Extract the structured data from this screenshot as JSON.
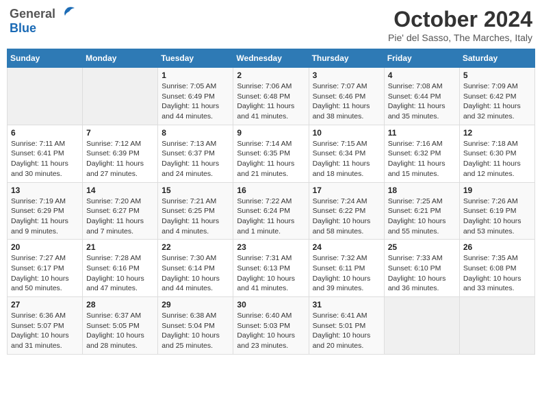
{
  "header": {
    "logo_general": "General",
    "logo_blue": "Blue",
    "month_title": "October 2024",
    "location": "Pie' del Sasso, The Marches, Italy"
  },
  "days_of_week": [
    "Sunday",
    "Monday",
    "Tuesday",
    "Wednesday",
    "Thursday",
    "Friday",
    "Saturday"
  ],
  "weeks": [
    [
      {
        "day": null
      },
      {
        "day": null
      },
      {
        "day": 1,
        "sunrise": "Sunrise: 7:05 AM",
        "sunset": "Sunset: 6:49 PM",
        "daylight": "Daylight: 11 hours and 44 minutes."
      },
      {
        "day": 2,
        "sunrise": "Sunrise: 7:06 AM",
        "sunset": "Sunset: 6:48 PM",
        "daylight": "Daylight: 11 hours and 41 minutes."
      },
      {
        "day": 3,
        "sunrise": "Sunrise: 7:07 AM",
        "sunset": "Sunset: 6:46 PM",
        "daylight": "Daylight: 11 hours and 38 minutes."
      },
      {
        "day": 4,
        "sunrise": "Sunrise: 7:08 AM",
        "sunset": "Sunset: 6:44 PM",
        "daylight": "Daylight: 11 hours and 35 minutes."
      },
      {
        "day": 5,
        "sunrise": "Sunrise: 7:09 AM",
        "sunset": "Sunset: 6:42 PM",
        "daylight": "Daylight: 11 hours and 32 minutes."
      }
    ],
    [
      {
        "day": 6,
        "sunrise": "Sunrise: 7:11 AM",
        "sunset": "Sunset: 6:41 PM",
        "daylight": "Daylight: 11 hours and 30 minutes."
      },
      {
        "day": 7,
        "sunrise": "Sunrise: 7:12 AM",
        "sunset": "Sunset: 6:39 PM",
        "daylight": "Daylight: 11 hours and 27 minutes."
      },
      {
        "day": 8,
        "sunrise": "Sunrise: 7:13 AM",
        "sunset": "Sunset: 6:37 PM",
        "daylight": "Daylight: 11 hours and 24 minutes."
      },
      {
        "day": 9,
        "sunrise": "Sunrise: 7:14 AM",
        "sunset": "Sunset: 6:35 PM",
        "daylight": "Daylight: 11 hours and 21 minutes."
      },
      {
        "day": 10,
        "sunrise": "Sunrise: 7:15 AM",
        "sunset": "Sunset: 6:34 PM",
        "daylight": "Daylight: 11 hours and 18 minutes."
      },
      {
        "day": 11,
        "sunrise": "Sunrise: 7:16 AM",
        "sunset": "Sunset: 6:32 PM",
        "daylight": "Daylight: 11 hours and 15 minutes."
      },
      {
        "day": 12,
        "sunrise": "Sunrise: 7:18 AM",
        "sunset": "Sunset: 6:30 PM",
        "daylight": "Daylight: 11 hours and 12 minutes."
      }
    ],
    [
      {
        "day": 13,
        "sunrise": "Sunrise: 7:19 AM",
        "sunset": "Sunset: 6:29 PM",
        "daylight": "Daylight: 11 hours and 9 minutes."
      },
      {
        "day": 14,
        "sunrise": "Sunrise: 7:20 AM",
        "sunset": "Sunset: 6:27 PM",
        "daylight": "Daylight: 11 hours and 7 minutes."
      },
      {
        "day": 15,
        "sunrise": "Sunrise: 7:21 AM",
        "sunset": "Sunset: 6:25 PM",
        "daylight": "Daylight: 11 hours and 4 minutes."
      },
      {
        "day": 16,
        "sunrise": "Sunrise: 7:22 AM",
        "sunset": "Sunset: 6:24 PM",
        "daylight": "Daylight: 11 hours and 1 minute."
      },
      {
        "day": 17,
        "sunrise": "Sunrise: 7:24 AM",
        "sunset": "Sunset: 6:22 PM",
        "daylight": "Daylight: 10 hours and 58 minutes."
      },
      {
        "day": 18,
        "sunrise": "Sunrise: 7:25 AM",
        "sunset": "Sunset: 6:21 PM",
        "daylight": "Daylight: 10 hours and 55 minutes."
      },
      {
        "day": 19,
        "sunrise": "Sunrise: 7:26 AM",
        "sunset": "Sunset: 6:19 PM",
        "daylight": "Daylight: 10 hours and 53 minutes."
      }
    ],
    [
      {
        "day": 20,
        "sunrise": "Sunrise: 7:27 AM",
        "sunset": "Sunset: 6:17 PM",
        "daylight": "Daylight: 10 hours and 50 minutes."
      },
      {
        "day": 21,
        "sunrise": "Sunrise: 7:28 AM",
        "sunset": "Sunset: 6:16 PM",
        "daylight": "Daylight: 10 hours and 47 minutes."
      },
      {
        "day": 22,
        "sunrise": "Sunrise: 7:30 AM",
        "sunset": "Sunset: 6:14 PM",
        "daylight": "Daylight: 10 hours and 44 minutes."
      },
      {
        "day": 23,
        "sunrise": "Sunrise: 7:31 AM",
        "sunset": "Sunset: 6:13 PM",
        "daylight": "Daylight: 10 hours and 41 minutes."
      },
      {
        "day": 24,
        "sunrise": "Sunrise: 7:32 AM",
        "sunset": "Sunset: 6:11 PM",
        "daylight": "Daylight: 10 hours and 39 minutes."
      },
      {
        "day": 25,
        "sunrise": "Sunrise: 7:33 AM",
        "sunset": "Sunset: 6:10 PM",
        "daylight": "Daylight: 10 hours and 36 minutes."
      },
      {
        "day": 26,
        "sunrise": "Sunrise: 7:35 AM",
        "sunset": "Sunset: 6:08 PM",
        "daylight": "Daylight: 10 hours and 33 minutes."
      }
    ],
    [
      {
        "day": 27,
        "sunrise": "Sunrise: 6:36 AM",
        "sunset": "Sunset: 5:07 PM",
        "daylight": "Daylight: 10 hours and 31 minutes."
      },
      {
        "day": 28,
        "sunrise": "Sunrise: 6:37 AM",
        "sunset": "Sunset: 5:05 PM",
        "daylight": "Daylight: 10 hours and 28 minutes."
      },
      {
        "day": 29,
        "sunrise": "Sunrise: 6:38 AM",
        "sunset": "Sunset: 5:04 PM",
        "daylight": "Daylight: 10 hours and 25 minutes."
      },
      {
        "day": 30,
        "sunrise": "Sunrise: 6:40 AM",
        "sunset": "Sunset: 5:03 PM",
        "daylight": "Daylight: 10 hours and 23 minutes."
      },
      {
        "day": 31,
        "sunrise": "Sunrise: 6:41 AM",
        "sunset": "Sunset: 5:01 PM",
        "daylight": "Daylight: 10 hours and 20 minutes."
      },
      {
        "day": null
      },
      {
        "day": null
      }
    ]
  ]
}
